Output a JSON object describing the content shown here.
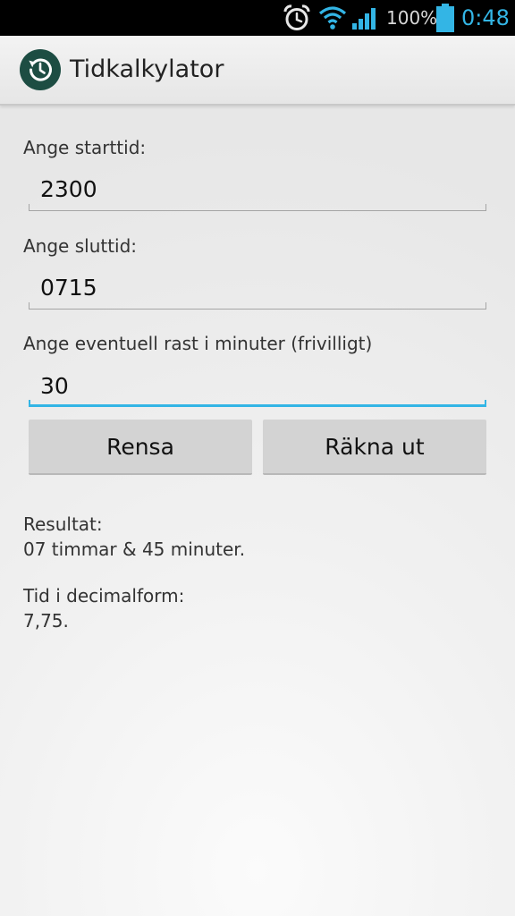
{
  "status_bar": {
    "icons": [
      "alarm-icon",
      "wifi-icon",
      "signal-icon",
      "battery-icon"
    ],
    "battery_percent": "100%",
    "time": "0:48",
    "accent_color": "#33b5e5"
  },
  "action_bar": {
    "app_icon": "clock-history-icon",
    "title": "Tidkalkylator"
  },
  "form": {
    "start_label": "Ange starttid:",
    "start_value": "2300",
    "end_label": "Ange sluttid:",
    "end_value": "0715",
    "break_label": "Ange eventuell rast i minuter (frivilligt)",
    "break_value": "30",
    "focus_color": "#33b5e5"
  },
  "buttons": {
    "clear": "Rensa",
    "calculate": "Räkna ut"
  },
  "result": {
    "label": "Resultat:",
    "value": "07 timmar & 45 minuter.",
    "decimal_label": "Tid i decimalform:",
    "decimal_value": "7,75."
  }
}
